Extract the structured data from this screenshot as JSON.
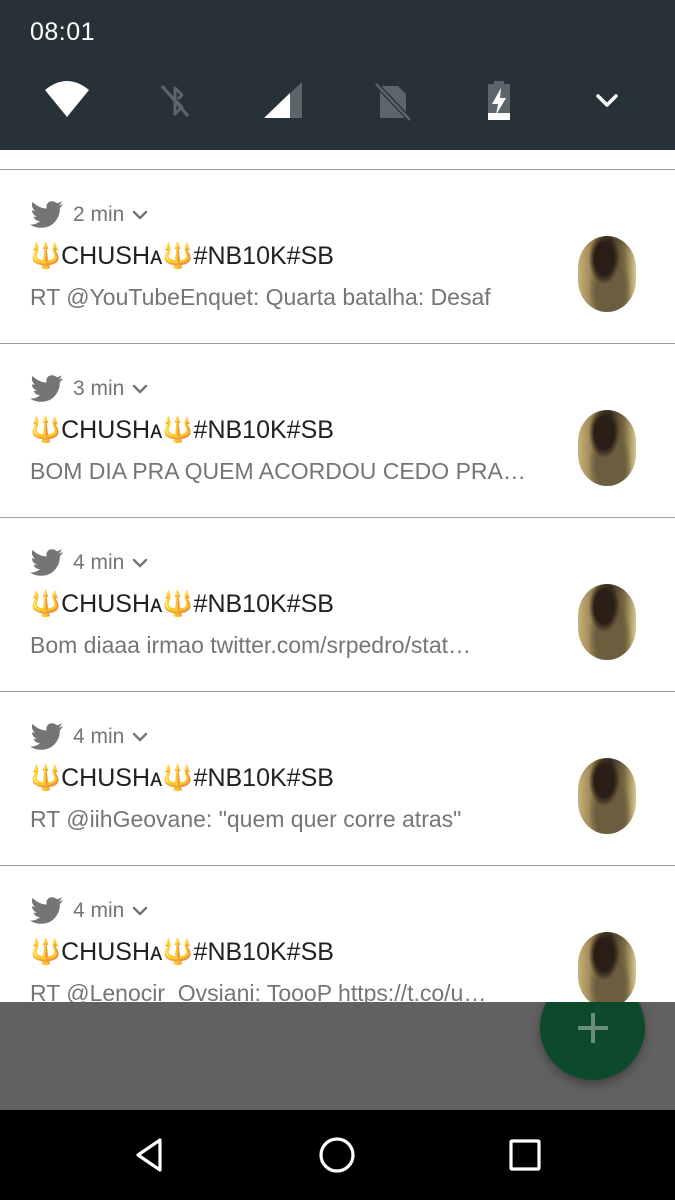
{
  "status_bar": {
    "time": "08:01",
    "icons": [
      "wifi-icon",
      "bluetooth-off-icon",
      "cell-signal-icon",
      "no-sim-icon",
      "battery-charging-icon",
      "expand-chevron-icon"
    ]
  },
  "notifications": [
    {
      "app_icon": "twitter-bird-icon",
      "time": "2 min",
      "title": "🔱CHUSHᴀ🔱#NB10K#SB",
      "body": "RT @YouTubeEnquet: Quarta batalha: Desaf"
    },
    {
      "app_icon": "twitter-bird-icon",
      "time": "3 min",
      "title": "🔱CHUSHᴀ🔱#NB10K#SB",
      "body": "BOM DIA PRA QUEM ACORDOU CEDO PRA…"
    },
    {
      "app_icon": "twitter-bird-icon",
      "time": "4 min",
      "title": "🔱CHUSHᴀ🔱#NB10K#SB",
      "body": "Bom diaaa irmao twitter.com/srpedro/stat…"
    },
    {
      "app_icon": "twitter-bird-icon",
      "time": "4 min",
      "title": "🔱CHUSHᴀ🔱#NB10K#SB",
      "body": "RT @iihGeovane: \"quem quer corre atras\""
    },
    {
      "app_icon": "twitter-bird-icon",
      "time": "4 min",
      "title": "🔱CHUSHᴀ🔱#NB10K#SB",
      "body": "RT @Lenocir_Ovsiani: ToooP https://t.co/u…"
    }
  ],
  "fab": {
    "icon": "plus-icon",
    "color": "#0d4a2c"
  },
  "nav_bar": {
    "icons": [
      "back-icon",
      "home-icon",
      "recents-icon"
    ]
  },
  "colors": {
    "shade_header": "#263238",
    "divider": "#9e9e9e",
    "secondary_text": "#757575"
  }
}
